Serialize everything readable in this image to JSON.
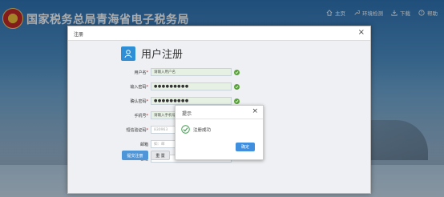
{
  "site": {
    "title": "国家税务总局青海省电子税务局",
    "nav": [
      {
        "label": "主页",
        "icon": "home-icon"
      },
      {
        "label": "环境检测",
        "icon": "wrench-icon"
      },
      {
        "label": "下载",
        "icon": "download-icon"
      },
      {
        "label": "帮助",
        "icon": "help-icon"
      }
    ]
  },
  "register": {
    "window_title": "注册",
    "heading": "用户注册",
    "fields": [
      {
        "label": "用户名",
        "required": "*",
        "value": "请输入用户名",
        "valid": true
      },
      {
        "label": "输入密码",
        "required": "*",
        "value": "●●●●●●●●●",
        "valid": true
      },
      {
        "label": "确认密码",
        "required": "*",
        "value": "●●●●●●●●●",
        "valid": true
      },
      {
        "label": "手机号",
        "required": "*",
        "value": "请输入手机号",
        "valid": false
      },
      {
        "label": "短信验证码",
        "required": "*",
        "value": "830963",
        "valid": false
      },
      {
        "label": "邮箱",
        "required": "",
        "value": "如：邮",
        "valid": false
      },
      {
        "label": "备注",
        "required": "",
        "value": "选填",
        "valid": false
      }
    ],
    "submit_label": "提交注册",
    "reset_label": "重 置"
  },
  "notice": {
    "title": "提示",
    "message": "注册成功",
    "ok_label": "确定"
  },
  "colors": {
    "accent": "#3f8fde",
    "success": "#55a534",
    "header_bg": "#2f74b5"
  }
}
